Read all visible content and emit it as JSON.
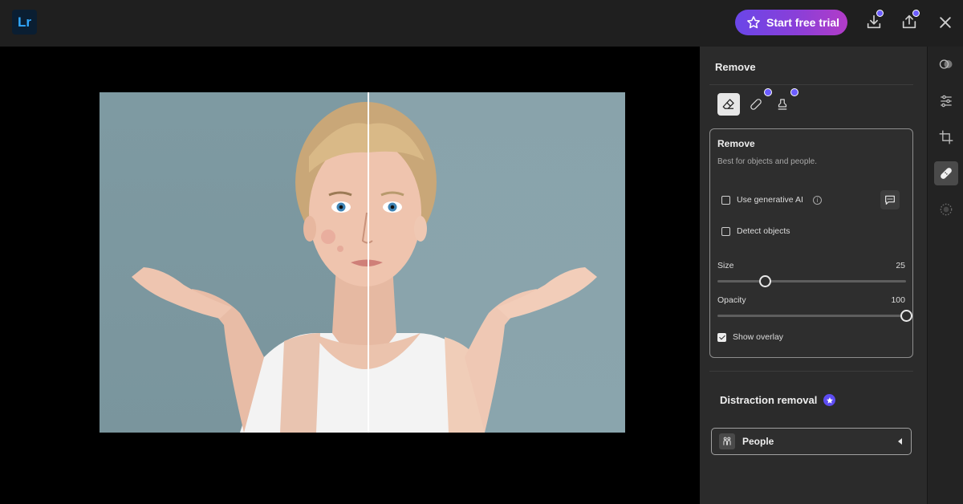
{
  "app": {
    "logo_text": "Lr"
  },
  "header": {
    "trial_label": "Start free trial"
  },
  "panel": {
    "title": "Remove",
    "remove_card": {
      "title": "Remove",
      "subtitle": "Best for objects and people.",
      "generative_ai": {
        "label": "Use generative AI",
        "checked": false,
        "info": "i"
      },
      "detect_objects": {
        "label": "Detect objects",
        "checked": false
      },
      "size": {
        "label": "Size",
        "value": "25",
        "fraction": 0.25
      },
      "opacity": {
        "label": "Opacity",
        "value": "100",
        "fraction": 1.0
      },
      "show_overlay": {
        "label": "Show overlay",
        "checked": true
      }
    },
    "distraction_removal": {
      "title": "Distraction removal",
      "people_label": "People"
    }
  },
  "colors": {
    "accent_purple": "#6b5cff",
    "trial_gradient_start": "#6a46e8",
    "trial_gradient_end": "#b23cc8"
  }
}
